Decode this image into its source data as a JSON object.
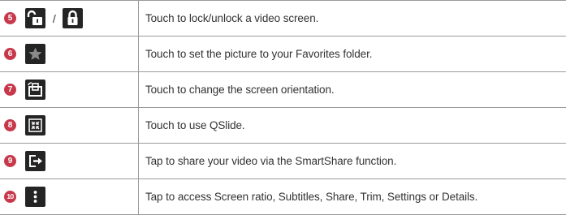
{
  "rows": [
    {
      "number": "5",
      "icons": [
        "unlock-icon",
        "lock-icon"
      ],
      "separator": "/",
      "description": "Touch to lock/unlock a video screen."
    },
    {
      "number": "6",
      "icons": [
        "star-icon"
      ],
      "description": "Touch to set the picture to your Favorites folder."
    },
    {
      "number": "7",
      "icons": [
        "rotate-screen-icon"
      ],
      "description": "Touch to change the screen orientation."
    },
    {
      "number": "8",
      "icons": [
        "qslide-icon"
      ],
      "description": "Touch to use QSlide."
    },
    {
      "number": "9",
      "icons": [
        "share-icon"
      ],
      "description": "Tap to share your video via the SmartShare function."
    },
    {
      "number": "10",
      "icons": [
        "more-options-icon"
      ],
      "description": "Tap to access Screen ratio, Subtitles, Share, Trim, Settings or Details."
    }
  ],
  "colors": {
    "number_badge": "#c8384b",
    "icon_background": "#242424",
    "rule": "#9a9a9a",
    "text": "#333333"
  }
}
